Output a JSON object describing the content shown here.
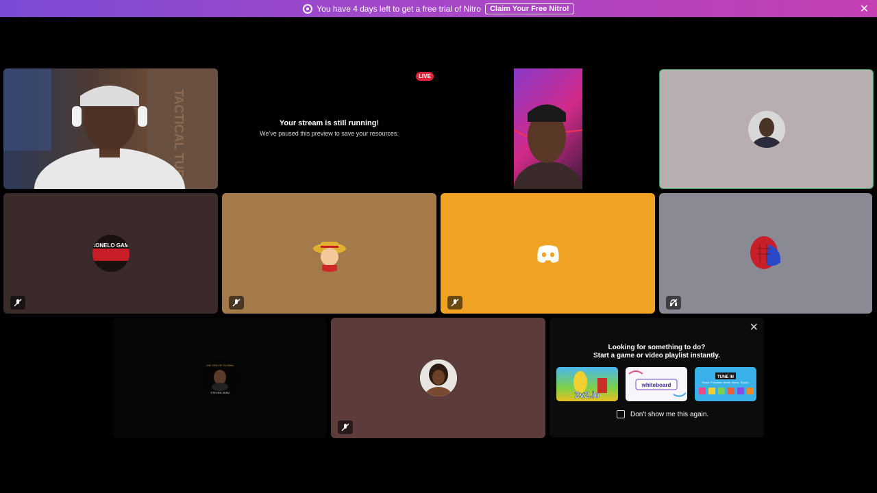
{
  "banner": {
    "message": "You have 4 days left to get a free trial of Nitro",
    "claim_button": "Claim Your Free Nitro!",
    "close": "✕"
  },
  "stream": {
    "live_badge": "LIVE",
    "title": "Your stream is still running!",
    "subtitle": "We've paused this preview to save your resources."
  },
  "tiles": {
    "tactical_text": "TACTICAL TURKEY",
    "gaming_text": "RONELO GAMI",
    "steven_text": "THE CEO OF GLOBAL",
    "steven_sub": "STEVEN JEAN"
  },
  "activity": {
    "close": "✕",
    "heading": "Looking for something to do?",
    "subheading": "Start a game or video playlist instantly.",
    "dont_show": "Don't show me this again.",
    "cards": [
      {
        "label": "2v2.io"
      },
      {
        "label": "whiteboard"
      },
      {
        "label": "TUNE IN"
      }
    ],
    "card_sub": "Radio. Podcasts. Music. News. Sports."
  },
  "colors": {
    "tile_dark_brown": "#3a2a2a",
    "tile_tan": "#a57a4a",
    "tile_orange": "#f0a323",
    "tile_gray": "#8a8a95",
    "tile_mauve": "#5c3b3b",
    "tile_light": "#b8aeb0",
    "speaking_border": "#3ba55d"
  }
}
